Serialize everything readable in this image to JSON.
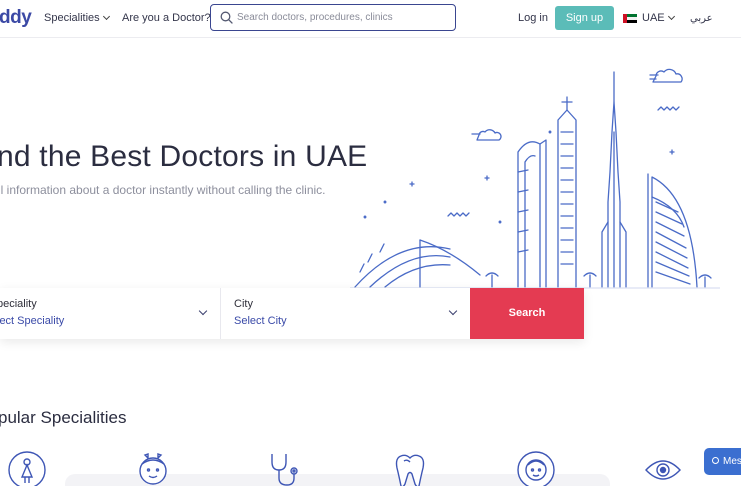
{
  "header": {
    "logo_text": "ddy",
    "logo_sub": "",
    "nav": {
      "specialities": "Specialities",
      "doctor": "Are you a Doctor?"
    },
    "search": {
      "placeholder": "Search doctors, procedures, clinics",
      "value": ""
    },
    "login": "Log in",
    "signup": "Sign up",
    "country": "UAE",
    "language": "عربي"
  },
  "hero": {
    "title": "nd the Best Doctors in UAE",
    "subtitle": "ll information about a doctor instantly without calling the clinic."
  },
  "search_panel": {
    "speciality_label": "peciality",
    "speciality_value": "lect Speciality",
    "city_label": "City",
    "city_value": "Select City",
    "search_button": "Search"
  },
  "popular": {
    "title": "pular Specialities",
    "icons": [
      "gynecology-icon",
      "pediatrics-icon",
      "general-physician-icon",
      "dentist-icon",
      "dermatology-icon",
      "ophthalmology-icon"
    ]
  },
  "chat": {
    "label": "Mes"
  },
  "colors": {
    "brand": "#3b49a5",
    "signup": "#5bbcb8",
    "search_button": "#e43b52",
    "link": "#3a4aa8",
    "illustration": "#4a6bc7"
  }
}
